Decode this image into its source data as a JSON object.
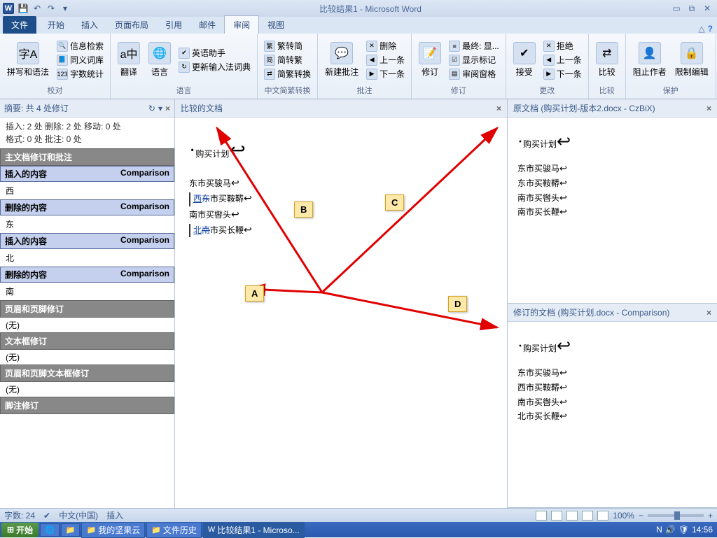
{
  "titlebar": {
    "title": "比较结果1 - Microsoft Word"
  },
  "tabs": {
    "file": "文件",
    "t0": "开始",
    "t1": "插入",
    "t2": "页面布局",
    "t3": "引用",
    "t4": "邮件",
    "t5": "审阅",
    "t6": "视图"
  },
  "ribbon": {
    "g0": {
      "label": "校对",
      "spell": "拼写和语法",
      "r0": "信息检索",
      "r1": "同义词库",
      "r2": "字数统计"
    },
    "g1": {
      "label": "语言",
      "trans": "翻译",
      "lang": "语言",
      "r0": "英语助手",
      "r1": "更新输入法词典"
    },
    "g2": {
      "label": "中文简繁转换",
      "r0": "繁转简",
      "r1": "简转繁",
      "r2": "简繁转换"
    },
    "g3": {
      "label": "批注",
      "new": "新建批注",
      "r0": "删除",
      "r1": "上一条",
      "r2": "下一条"
    },
    "g4": {
      "label": "修订",
      "track": "修订",
      "r0": "最终: 显...",
      "r1": "显示标记",
      "r2": "审阅窗格"
    },
    "g5": {
      "label": "更改",
      "accept": "接受",
      "r0": "拒绝",
      "r1": "上一条",
      "r2": "下一条"
    },
    "g6": {
      "label": "比较",
      "btn": "比较"
    },
    "g7": {
      "label": "保护",
      "b0": "阻止作者",
      "b1": "限制编辑"
    }
  },
  "revpane": {
    "summary_title": "摘要: 共 4 处修订",
    "stat1": "插入: 2 处 删除: 2 处 移动: 0 处",
    "stat2": "格式: 0 处 批注: 0 处",
    "sec_main": "主文档修订和批注",
    "author": "Comparison",
    "h_ins": "插入的内容",
    "h_del": "删除的内容",
    "v0": "西",
    "v1": "东",
    "v2": "北",
    "v3": "南",
    "sec_hf": "页眉和页脚修订",
    "sec_tb": "文本框修订",
    "sec_hftb": "页眉和页脚文本框修订",
    "sec_fn": "脚注修订",
    "none": "(无)"
  },
  "center": {
    "hdr": "比较的文档",
    "title": "购买计划",
    "l1a": "东市买骏马",
    "l2a": "西",
    "l2b": "东",
    "l2c": "市买鞍鞯",
    "l3a": "南市买辔头",
    "l4a": "北",
    "l4b": "南",
    "l4c": "市买长鞭"
  },
  "original": {
    "hdr": "原文档 (购买计划-版本2.docx - CzBiX)",
    "title": "购买计划",
    "l1": "东市买骏马",
    "l2": "东市买鞍鞯",
    "l3": "南市买辔头",
    "l4": "南市买长鞭"
  },
  "revised": {
    "hdr": "修订的文档 (购买计划.docx - Comparison)",
    "title": "购买计划",
    "l1": "东市买骏马",
    "l2": "西市买鞍鞯",
    "l3": "南市买辔头",
    "l4": "北市买长鞭"
  },
  "annot": {
    "a": "A",
    "b": "B",
    "c": "C",
    "d": "D"
  },
  "statusbar": {
    "words": "字数: 24",
    "lang": "中文(中国)",
    "mode": "插入",
    "zoom": "100%"
  },
  "taskbar": {
    "start": "开始",
    "t0": "我的坚果云",
    "t1": "文件历史",
    "t2": "比较结果1 - Microso...",
    "time": "14:56"
  }
}
